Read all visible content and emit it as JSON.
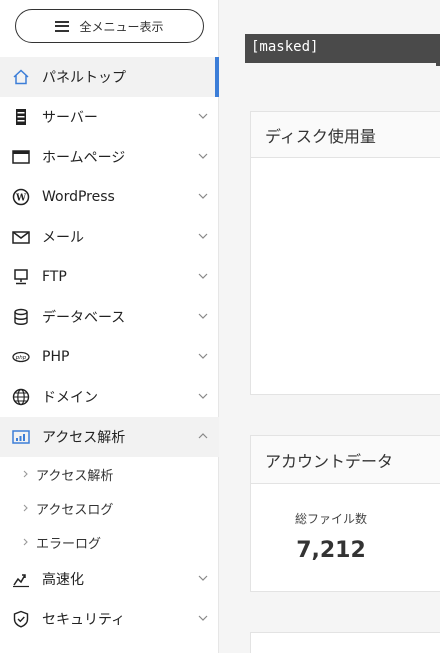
{
  "menu_button": {
    "label": "全メニュー表示"
  },
  "nav": [
    {
      "label": "パネルトップ",
      "icon": "home-icon"
    },
    {
      "label": "サーバー",
      "icon": "server-icon"
    },
    {
      "label": "ホームページ",
      "icon": "browser-window-icon"
    },
    {
      "label": "WordPress",
      "icon": "wordpress-icon"
    },
    {
      "label": "メール",
      "icon": "envelope-icon"
    },
    {
      "label": "FTP",
      "icon": "ftp-computer-icon"
    },
    {
      "label": "データベース",
      "icon": "database-icon"
    },
    {
      "label": "PHP",
      "icon": "php-icon"
    },
    {
      "label": "ドメイン",
      "icon": "globe-icon"
    },
    {
      "label": "アクセス解析",
      "icon": "bar-chart-icon"
    },
    {
      "label": "高速化",
      "icon": "speed-icon"
    },
    {
      "label": "セキュリティ",
      "icon": "shield-icon"
    }
  ],
  "subnav": [
    {
      "label": "アクセス解析"
    },
    {
      "label": "アクセスログ"
    },
    {
      "label": "エラーログ"
    }
  ],
  "main": {
    "masked_text": "[masked]",
    "disk_card": {
      "title": "ディスク使用量"
    },
    "account_card": {
      "title": "アカウントデータ",
      "stat_label": "総ファイル数",
      "stat_value": "7,212"
    }
  },
  "colors": {
    "accent": "#3c7ed8",
    "masked_bg": "#4a4a4a"
  }
}
